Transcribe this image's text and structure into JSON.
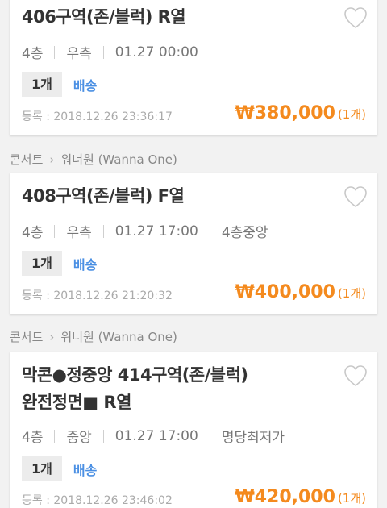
{
  "listings": [
    {
      "title_line1": "406구역(존/블럭) R열",
      "title_line2": "",
      "floor": "4층",
      "side": "우측",
      "datetime": "01.27 00:00",
      "extra": "",
      "qty_tag": "1개",
      "shipping": "배송",
      "registered": "등록 : 2018.12.26 23:36:17",
      "price": "₩380,000",
      "price_qty": "(1개)"
    },
    {
      "breadcrumb": {
        "category": "콘서트",
        "artist": "워너원 (Wanna One)"
      },
      "title_line1": "408구역(존/블럭) F열",
      "title_line2": "",
      "floor": "4층",
      "side": "우측",
      "datetime": "01.27 17:00",
      "extra": "4층중앙",
      "qty_tag": "1개",
      "shipping": "배송",
      "registered": "등록 : 2018.12.26 21:20:32",
      "price": "₩400,000",
      "price_qty": "(1개)"
    },
    {
      "breadcrumb": {
        "category": "콘서트",
        "artist": "워너원 (Wanna One)"
      },
      "title_line1": "막콘●정중앙 414구역(존/블럭)",
      "title_line2": "완전정면■ R열",
      "floor": "4층",
      "side": "중앙",
      "datetime": "01.27 17:00",
      "extra": "명당최저가",
      "qty_tag": "1개",
      "shipping": "배송",
      "registered": "등록 : 2018.12.26 23:46:02",
      "price": "₩420,000",
      "price_qty": "(1개)"
    }
  ],
  "colors": {
    "price": "#f48a1e",
    "shipping": "#4a8fe3",
    "background": "#f2f2f2"
  },
  "icons": {
    "favorite": "heart-outline-icon",
    "breadcrumb_separator": "chevron-right-icon"
  }
}
